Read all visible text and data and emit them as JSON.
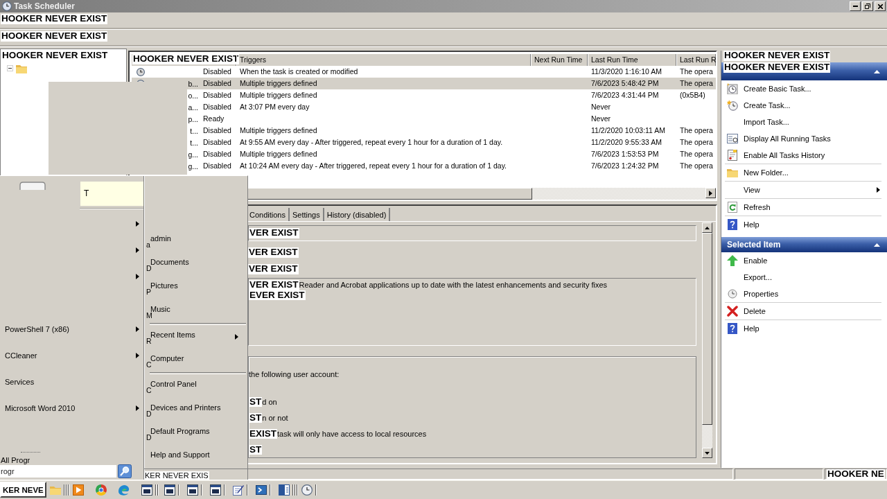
{
  "window": {
    "title": "Task Scheduler"
  },
  "menu_bar": {
    "overlay": "HOOKER NEVER EXIST"
  },
  "toolbar": {
    "overlay": "HOOKER NEVER EXIST"
  },
  "tree": {
    "overlay": "HOOKER NEVER EXIST"
  },
  "task_list": {
    "header_overlay": "HOOKER NEVER EXIST",
    "columns": [
      "Triggers",
      "Next Run Time",
      "Last Run Time",
      "Last Run R"
    ],
    "rows": [
      {
        "status": "Disabled",
        "trigger": "When the task is created or modified",
        "last_run": "11/3/2020 1:16:10 AM",
        "result": "The opera",
        "selected": false
      },
      {
        "name": "b...",
        "status": "Disabled",
        "trigger": "Multiple triggers defined",
        "last_run": "7/6/2023 5:48:42 PM",
        "result": "The opera",
        "selected": true
      },
      {
        "name": "o...",
        "status": "Disabled",
        "trigger": "Multiple triggers defined",
        "last_run": "7/6/2023 4:31:44 PM",
        "result": "(0x5B4)",
        "selected": false
      },
      {
        "name": "a...",
        "status": "Disabled",
        "trigger": "At 3:07 PM every day",
        "last_run": "Never",
        "selected": false
      },
      {
        "name": "p...",
        "status": "Ready",
        "last_run": "Never",
        "selected": false
      },
      {
        "name": "t...",
        "status": "Disabled",
        "trigger": "Multiple triggers defined",
        "last_run": "11/2/2020 10:03:11 AM",
        "result": "The opera",
        "selected": false
      },
      {
        "name": "t...",
        "status": "Disabled",
        "trigger": "At 9:55 AM every day - After triggered, repeat every 1 hour for a duration of 1 day.",
        "last_run": "11/2/2020 9:55:33 AM",
        "result": "The opera",
        "selected": false
      },
      {
        "name": "g...",
        "status": "Disabled",
        "trigger": "Multiple triggers defined",
        "last_run": "7/6/2023 1:53:53 PM",
        "result": "The opera",
        "selected": false
      },
      {
        "name": "g...",
        "status": "Disabled",
        "trigger": "At 10:24 AM every day - After triggered, repeat every 1 hour for a duration of 1 day.",
        "last_run": "7/6/2023 1:24:32 PM",
        "result": "The opera",
        "selected": false
      }
    ]
  },
  "details": {
    "tabs": [
      {
        "label": "Conditions",
        "selected": false
      },
      {
        "label": "Settings",
        "selected": false
      },
      {
        "label": "History (disabled)",
        "selected": false
      }
    ],
    "fields": [
      {
        "kind": "box",
        "overlay": "VER EXIST"
      },
      {
        "kind": "line",
        "overlay": "VER EXIST"
      },
      {
        "kind": "line",
        "overlay": "VER EXIST"
      },
      {
        "kind": "area",
        "overlay": "VER EXIST",
        "text": "Reader and Acrobat applications up to date with the latest enhancements and security fixes",
        "overlay_2": "EVER EXIST"
      }
    ],
    "security": {
      "lines": [
        {
          "text": "the following user account:"
        },
        {
          "overlay": "ST",
          "text": "d on"
        },
        {
          "overlay": "ST",
          "text": "n or not"
        },
        {
          "overlay": "EXIST",
          "text": "task will only have access to local resources"
        },
        {
          "overlay": "ST"
        }
      ]
    }
  },
  "actions": {
    "overlay": "HOOKER NEVER EXIST",
    "sections": [
      {
        "title_overlay": "HOOKER NEVER EXIST",
        "expanded": true,
        "groups": [
          [
            {
              "label": "Create Basic Task...",
              "submenu": false
            },
            {
              "label": "Create Task...",
              "submenu": false
            },
            {
              "label": "Import Task...",
              "submenu": false
            },
            {
              "label": "Display All Running Tasks",
              "submenu": false
            },
            {
              "label": "Enable All Tasks History",
              "submenu": false
            }
          ],
          [
            {
              "label": "New Folder...",
              "submenu": false
            }
          ],
          [
            {
              "label": "View",
              "submenu": true
            }
          ],
          [
            {
              "label": "Refresh",
              "submenu": false
            }
          ],
          [
            {
              "label": "Help",
              "submenu": false
            }
          ]
        ]
      },
      {
        "title": "Selected Item",
        "expanded": true,
        "groups": [
          [
            {
              "label": "Enable",
              "submenu": false
            },
            {
              "label": "Export...",
              "submenu": false
            },
            {
              "label": "Properties",
              "submenu": false
            }
          ],
          [
            {
              "label": "Delete",
              "submenu": false
            }
          ],
          [
            {
              "label": "Help",
              "submenu": false
            }
          ]
        ]
      }
    ]
  },
  "status_bar": {
    "overlay": "HOOKER NE"
  },
  "start_menu": {
    "user_tile": "T",
    "programs": [
      [
        {
          "submenu": true
        },
        {
          "submenu": true
        },
        {
          "submenu": true
        }
      ],
      [
        {
          "label": "PowerShell 7 (x86)",
          "submenu": true
        },
        {
          "label": "CCleaner",
          "submenu": true
        },
        {
          "label": "Services",
          "submenu": false
        },
        {
          "label": "Microsoft Word 2010",
          "submenu": true
        }
      ]
    ],
    "all_programs": "All Progr",
    "search": {
      "placeholder": "rogr"
    },
    "places": [
      [
        {
          "key": "a",
          "label": "admin",
          "submenu": false
        },
        {
          "key": "D",
          "label": "Documents",
          "submenu": false
        },
        {
          "key": "P",
          "label": "Pictures",
          "submenu": false
        },
        {
          "key": "M",
          "label": "Music",
          "submenu": false
        }
      ],
      [
        {
          "key": "R",
          "label": "Recent Items",
          "submenu": true
        },
        {
          "key": "C",
          "label": "Computer",
          "submenu": false
        }
      ],
      [
        {
          "key": "C",
          "label": "Control Panel",
          "submenu": false
        },
        {
          "key": "D",
          "label": "Devices and Printers",
          "submenu": false
        },
        {
          "key": "D",
          "label": "Default Programs",
          "submenu": false
        },
        {
          "label": "Help and Support",
          "submenu": false
        }
      ]
    ],
    "shutdown_overlay": "KER NEVER EXIS"
  },
  "taskbar": {
    "start_overlay": "KER NEVE"
  }
}
